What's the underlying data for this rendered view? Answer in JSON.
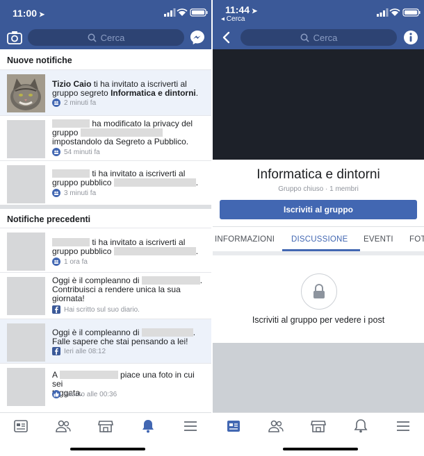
{
  "left": {
    "time": "11:00",
    "search_placeholder": "Cerca",
    "sections": {
      "new": "Nuove notifiche",
      "previous": "Notifiche precedenti"
    },
    "notifications": [
      {
        "pre": "",
        "name": "Tizio Caio",
        "mid": " ti ha invitato a iscriverti al gruppo segreto ",
        "group": "Informatica e dintorni",
        "post": ".",
        "time": "2 minuti fa",
        "icon": "group-icon"
      },
      {
        "line1": "ha modificato la privacy del",
        "line2": "gruppo",
        "line3": "impostandolo da Segreto a Pubblico.",
        "time": "54 minuti fa",
        "icon": "group-icon"
      },
      {
        "line1": "ti ha invitato a iscriverti al",
        "line2": "gruppo pubblico",
        "line3": ".",
        "time": "3 minuti fa",
        "icon": "group-icon"
      },
      {
        "line1": "ti ha invitato a iscriverti al",
        "line2": "gruppo pubblico",
        "line3": ".",
        "time": "1 ora fa",
        "icon": "group-icon"
      },
      {
        "line1": "Oggi è il compleanno di",
        "line1_end": ".",
        "line2": "Contribuisci a rendere unica la sua",
        "line3": "giornata!",
        "time": "Hai scritto sul suo diario.",
        "icon": "facebook-icon"
      },
      {
        "line1": "Oggi è il compleanno di",
        "line1_end": ".",
        "line2": "Falle sapere che stai pensando a lei!",
        "time": "Ieri alle 08:12",
        "icon": "facebook-icon"
      },
      {
        "line1": "A",
        "line1_end": "piace una foto in cui sei",
        "line2": "taggata.",
        "time": "sabato alle 00:36",
        "icon": "like-icon"
      }
    ],
    "tabs": [
      "news-feed-icon",
      "friends-icon",
      "marketplace-icon",
      "notifications-bell-icon",
      "menu-icon"
    ]
  },
  "right": {
    "time": "11:44",
    "back_label": "◂ Cerca",
    "search_placeholder": "Cerca",
    "group_name": "Informatica e dintorni",
    "group_meta": "Gruppo chiuso · 1 membri",
    "join_button": "Iscriviti al gruppo",
    "tabs": [
      "INFORMAZIONI",
      "DISCUSSIONE",
      "EVENTI",
      "FOTO"
    ],
    "active_tab": "DISCUSSIONE",
    "locked_message": "Iscriviti al gruppo per vedere i post"
  },
  "colors": {
    "brand": "#3b5998",
    "accent": "#4267b2",
    "unread_bg": "#edf2fa"
  }
}
